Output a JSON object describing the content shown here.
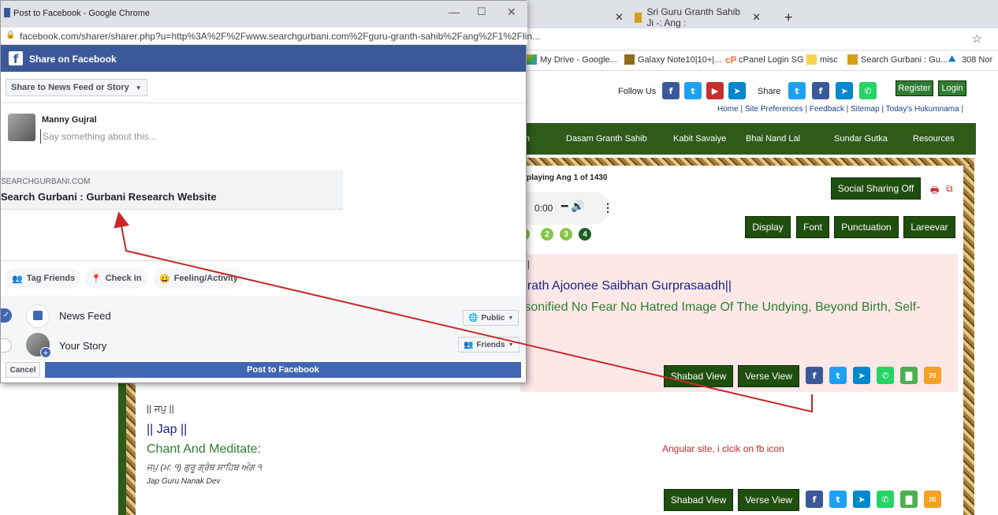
{
  "browser": {
    "tabs": [
      {
        "label": "Sri Guru Granth Sahib Ji -: Ang :"
      }
    ],
    "bookmarks": [
      "My Drive - Google...",
      "Galaxy Note10|10+|...",
      "cPanel Login SG",
      "misc",
      "Search Gurbani : Gu...",
      "308 Nor"
    ]
  },
  "popup": {
    "window_title": "Post to Facebook - Google Chrome",
    "url": "facebook.com/sharer/sharer.php?u=http%3A%2F%2Fwww.searchgurbani.com%2Fguru-granth-sahib%2Fang%2F1%2Flin...",
    "header_title": "Share on Facebook",
    "share_target": "Share to News Feed or Story",
    "user_name": "Manny Gujral",
    "placeholder": "Say something about this...",
    "link_domain": "SEARCHGURBANI.COM",
    "link_title": "Search Gurbani : Gurbani Research Website",
    "chips": [
      "Tag Friends",
      "Check in",
      "Feeling/Activity"
    ],
    "dest_news_feed": "News Feed",
    "dest_story": "Your Story",
    "privacy_public": "Public",
    "privacy_friends": "Friends",
    "cancel": "Cancel",
    "post": "Post to Facebook"
  },
  "site": {
    "follow_us": "Follow Us",
    "share": "Share",
    "register": "Register",
    "login": "Login",
    "toplinks": "Home | Site Preferences | Feedback | Sitemap | Today's Hukumnama |",
    "nav": [
      "n",
      "Dasam Granth Sahib",
      "Kabit Savaiye",
      "Bhai Nand Lal",
      "Sundar Gutka",
      "Resources"
    ],
    "displaying": "playing Ang 1 of 1430",
    "audio_time": "0:00",
    "social_sharing": "Social Sharing Off",
    "toolbar": [
      "Display",
      "Font",
      "Punctuation",
      "Lareevar"
    ],
    "pages": [
      "2",
      "3",
      "4"
    ],
    "verse1_gurmukhi": "' ||",
    "verse1_translit": "orath Ajoonee Saibhan Gurprasaadh||",
    "verse1_translation": "rsonified No Fear No Hatred Image Of The Undying, Beyond Birth, Self-",
    "shabad_view": "Shabad View",
    "verse_view": "Verse View",
    "verse2_gurmukhi": "|| ਜਪੁ ||",
    "verse2_translit": "|| Jap ||",
    "verse2_translation": "Chant And Meditate:",
    "verse2_source": "ਜਪੁ (ਮ: ੧) ਗੁਰੂ ਗ੍ਰੰਥ ਸਾਹਿਬ ਅੰਗ ੧",
    "verse2_author": "Jap Guru Nanak Dev"
  },
  "annotation": "Angular site, i clcik on fb icon"
}
